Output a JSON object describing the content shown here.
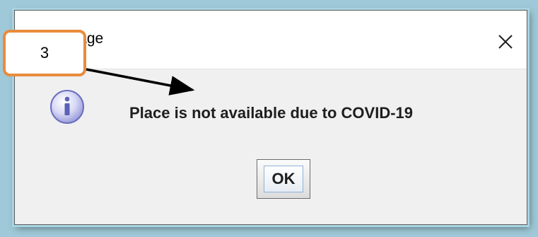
{
  "window": {
    "title": "Message",
    "close_icon": "close-icon"
  },
  "dialog": {
    "icon": "information-icon",
    "message": "Place is not available due to COVID-19",
    "ok_label": "OK"
  },
  "annotation": {
    "callout_number": "3",
    "arrow_icon": "arrow-icon",
    "accent_color": "#e88c3e"
  }
}
